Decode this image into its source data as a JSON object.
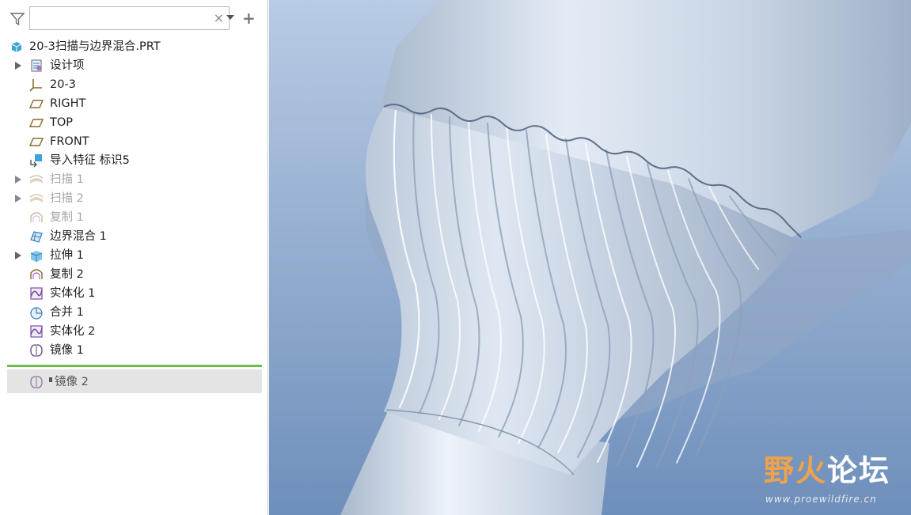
{
  "filter": {
    "search_placeholder": "",
    "search_value": "",
    "clear_glyph": "×",
    "add_glyph": "+"
  },
  "tree": {
    "root": {
      "label": "20-3扫描与边界混合.PRT",
      "icon": "part-icon"
    },
    "items": [
      {
        "label": "设计项",
        "icon": "design-items-icon",
        "expandable": true,
        "suppressed": false
      },
      {
        "label": "20-3",
        "icon": "coordinate-system-icon",
        "expandable": false,
        "suppressed": false
      },
      {
        "label": "RIGHT",
        "icon": "datum-plane-icon",
        "expandable": false,
        "suppressed": false
      },
      {
        "label": "TOP",
        "icon": "datum-plane-icon",
        "expandable": false,
        "suppressed": false
      },
      {
        "label": "FRONT",
        "icon": "datum-plane-icon",
        "expandable": false,
        "suppressed": false
      },
      {
        "label": "导入特征 标识5",
        "icon": "import-feature-icon",
        "expandable": false,
        "suppressed": false
      },
      {
        "label": "扫描 1",
        "icon": "sweep-icon",
        "expandable": true,
        "suppressed": true
      },
      {
        "label": "扫描 2",
        "icon": "sweep-icon",
        "expandable": true,
        "suppressed": true
      },
      {
        "label": "复制 1",
        "icon": "copy-surface-icon",
        "expandable": false,
        "suppressed": true
      },
      {
        "label": "边界混合 1",
        "icon": "boundary-blend-icon",
        "expandable": false,
        "suppressed": false
      },
      {
        "label": "拉伸 1",
        "icon": "extrude-icon",
        "expandable": true,
        "suppressed": false
      },
      {
        "label": "复制 2",
        "icon": "copy-surface-icon",
        "expandable": false,
        "suppressed": false
      },
      {
        "label": "实体化 1",
        "icon": "solidify-icon",
        "expandable": false,
        "suppressed": false
      },
      {
        "label": "合并 1",
        "icon": "merge-icon",
        "expandable": false,
        "suppressed": false
      },
      {
        "label": "实体化 2",
        "icon": "solidify-icon",
        "expandable": false,
        "suppressed": false
      },
      {
        "label": "镜像 1",
        "icon": "mirror-icon",
        "expandable": false,
        "suppressed": false
      }
    ],
    "after_insert": {
      "label": "镜像 2",
      "icon": "mirror-icon"
    }
  },
  "viewport": {
    "view_tag": "",
    "colors": {
      "background": "#7f9bc0",
      "model": "#c8d4e4",
      "accent_line": "#6abf4b"
    }
  },
  "watermark": {
    "title_a": "野",
    "title_b": "火",
    "title_c": "论坛",
    "url": "www.proewildfire.cn"
  }
}
